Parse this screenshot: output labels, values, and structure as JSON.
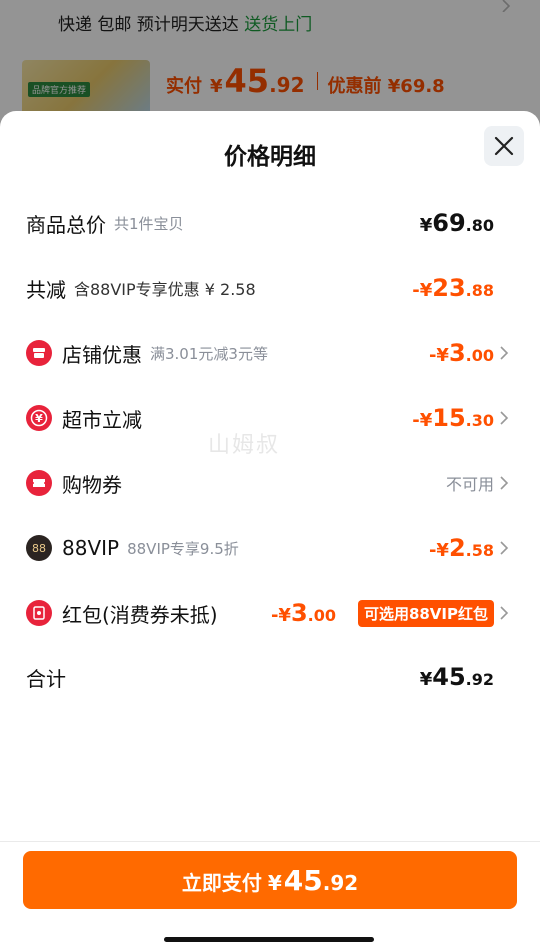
{
  "background": {
    "delivery_text": "快递 包邮 预计明天送达",
    "delivery_highlight": "送货上门",
    "thumb_tag": "品牌官方推荐",
    "actual_label": "实付",
    "actual_yen": "¥",
    "actual_int": "45",
    "actual_dec": ".92",
    "before_label": "优惠前 ¥69.8"
  },
  "sheet": {
    "title": "价格明细",
    "watermark": "山姆叔"
  },
  "rows": {
    "total": {
      "label": "商品总价",
      "sub": "共1件宝贝",
      "pre": "¥",
      "int": "69",
      "dec": ".80"
    },
    "discount": {
      "label": "共减",
      "sub": "含88VIP专享优惠 ¥ 2.58",
      "pre": "-¥",
      "int": "23",
      "dec": ".88"
    },
    "shop": {
      "label": "店铺优惠",
      "sub": "满3.01元减3元等",
      "pre": "-¥",
      "int": "3",
      "dec": ".00"
    },
    "market": {
      "label": "超市立减",
      "pre": "-¥",
      "int": "15",
      "dec": ".30"
    },
    "coupon": {
      "label": "购物券",
      "status": "不可用"
    },
    "vip": {
      "label": "88VIP",
      "sub": "88VIP专享9.5折",
      "pre": "-¥",
      "int": "2",
      "dec": ".58"
    },
    "redpack": {
      "label": "红包(消费券未抵)",
      "pre": "-¥",
      "int": "3",
      "dec": ".00",
      "pill": "可选用88VIP红包"
    },
    "sum": {
      "label": "合计",
      "pre": "¥",
      "int": "45",
      "dec": ".92"
    }
  },
  "pay": {
    "label": "立即支付",
    "yen": "¥",
    "int": "45",
    "dec": ".92"
  },
  "colors": {
    "accent": "#ff5000",
    "button": "#ff6a00",
    "icon_red": "#e8233b",
    "vip_dark": "#2b2421"
  }
}
